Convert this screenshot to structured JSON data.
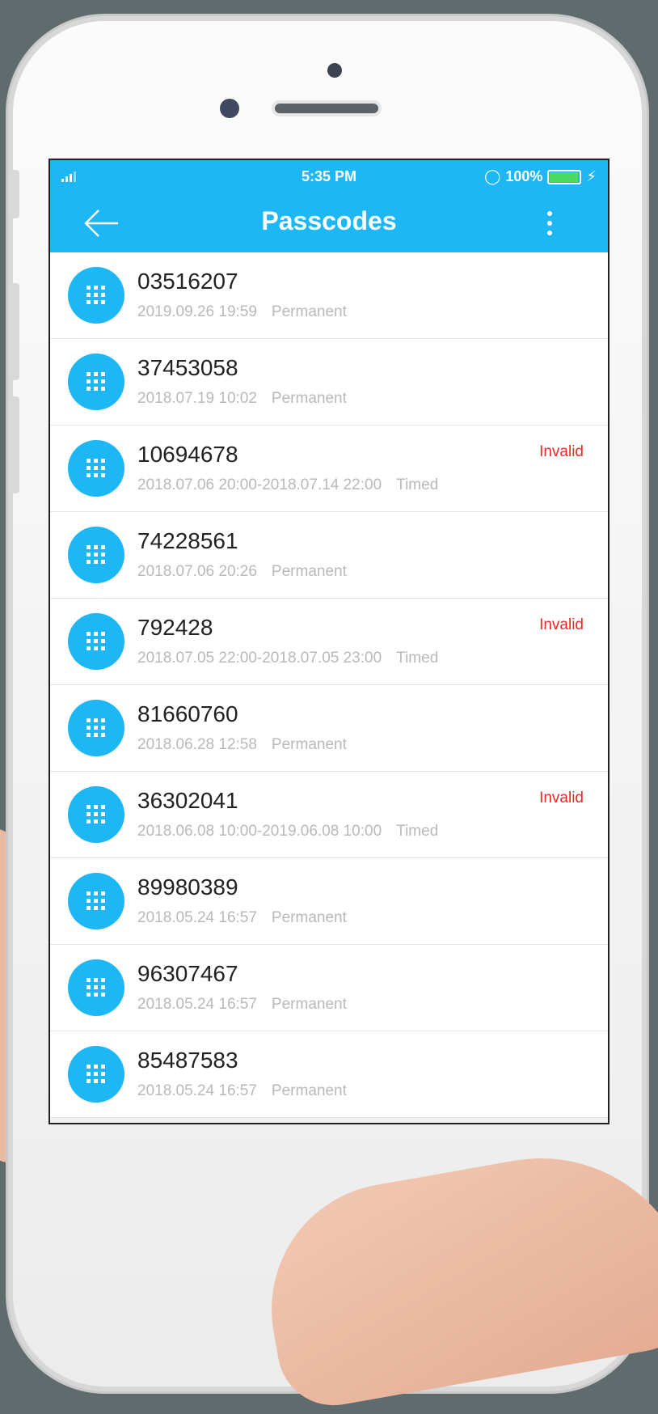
{
  "status_bar": {
    "time": "5:35 PM",
    "battery": "100%",
    "battery_level": 0.9
  },
  "nav": {
    "title": "Passcodes",
    "back_icon": "arrow-left-icon",
    "menu_icon": "more-vertical-icon"
  },
  "colors": {
    "accent": "#1cb7f4",
    "invalid": "#ee2727",
    "meta_text": "#b9b9b9"
  },
  "passcodes": [
    {
      "code": "03516207",
      "date": "2019.09.26 19:59",
      "type": "Permanent",
      "status": ""
    },
    {
      "code": "37453058",
      "date": "2018.07.19 10:02",
      "type": "Permanent",
      "status": ""
    },
    {
      "code": "10694678",
      "date": "2018.07.06 20:00-2018.07.14 22:00",
      "type": "Timed",
      "status": "Invalid"
    },
    {
      "code": "74228561",
      "date": "2018.07.06 20:26",
      "type": "Permanent",
      "status": ""
    },
    {
      "code": "792428",
      "date": "2018.07.05 22:00-2018.07.05 23:00",
      "type": "Timed",
      "status": "Invalid"
    },
    {
      "code": "81660760",
      "date": "2018.06.28 12:58",
      "type": "Permanent",
      "status": ""
    },
    {
      "code": "36302041",
      "date": "2018.06.08 10:00-2019.06.08 10:00",
      "type": "Timed",
      "status": "Invalid"
    },
    {
      "code": "89980389",
      "date": "2018.05.24 16:57",
      "type": "Permanent",
      "status": ""
    },
    {
      "code": "96307467",
      "date": "2018.05.24 16:57",
      "type": "Permanent",
      "status": ""
    },
    {
      "code": "85487583",
      "date": "2018.05.24 16:57",
      "type": "Permanent",
      "status": ""
    }
  ]
}
